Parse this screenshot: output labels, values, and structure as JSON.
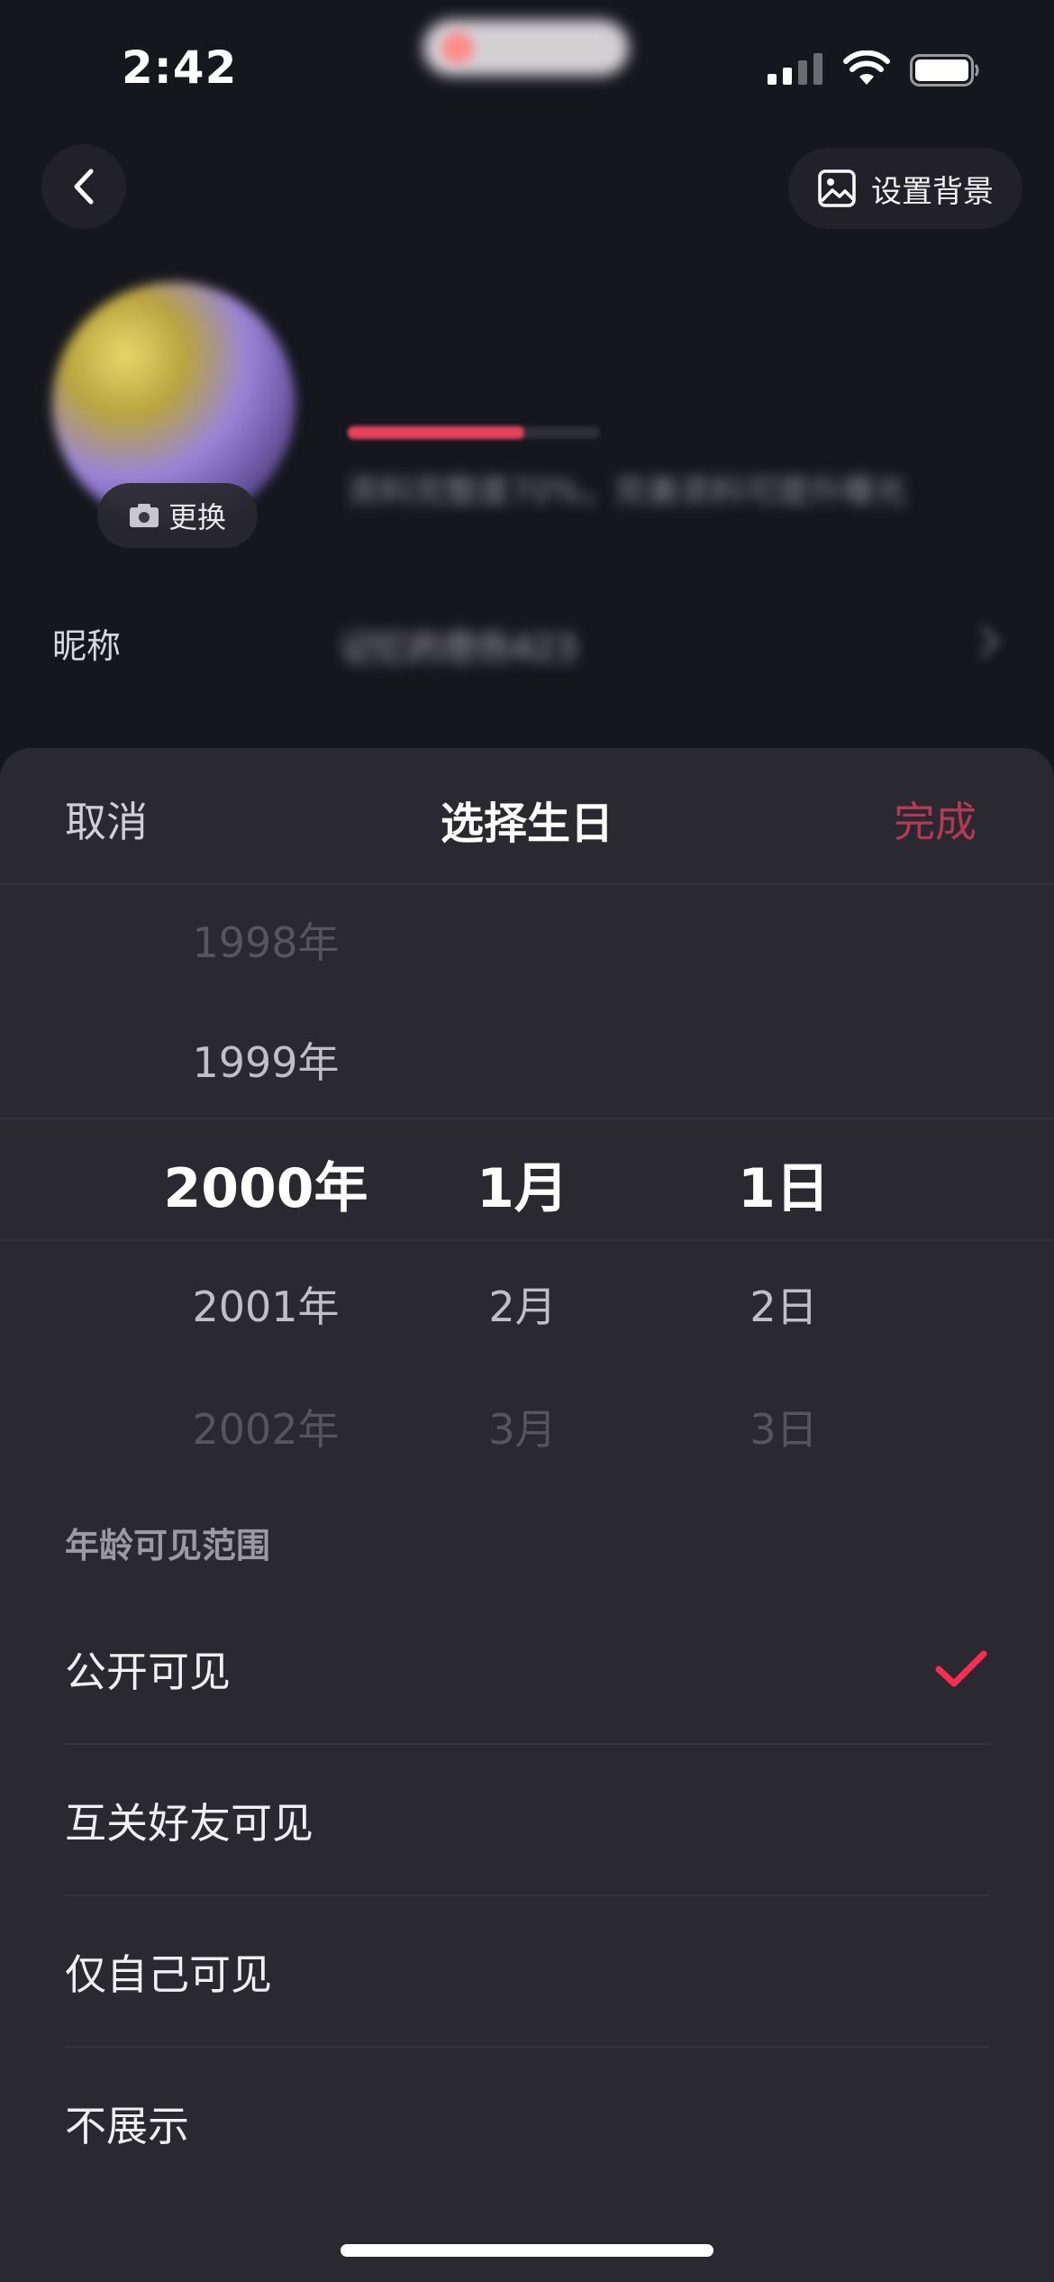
{
  "status_bar": {
    "time": "2:42"
  },
  "header": {
    "set_background_label": "设置背景"
  },
  "profile": {
    "change_label": "更换",
    "completion_hint": "资料完整度70%，完善资料可提升曝光",
    "completion_percent": 0.7,
    "nickname_label": "昵称",
    "nickname_value": "记忆的悲伤423"
  },
  "sheet": {
    "cancel_label": "取消",
    "title": "选择生日",
    "done_label": "完成",
    "picker": {
      "years": [
        "1998年",
        "1999年",
        "2000年",
        "2001年",
        "2002年"
      ],
      "months": [
        "1月",
        "2月",
        "3月"
      ],
      "days": [
        "1日",
        "2日",
        "3日"
      ],
      "selected": {
        "year": "2000年",
        "month": "1月",
        "day": "1日"
      }
    },
    "visibility": {
      "title": "年龄可见范围",
      "options": [
        "公开可见",
        "互关好友可见",
        "仅自己可见",
        "不展示"
      ],
      "selected_index": 0
    }
  },
  "colors": {
    "accent": "#fe2c55",
    "done_dim": "#b23a58",
    "sheet_bg": "#2a2930",
    "page_bg": "#16161d"
  }
}
